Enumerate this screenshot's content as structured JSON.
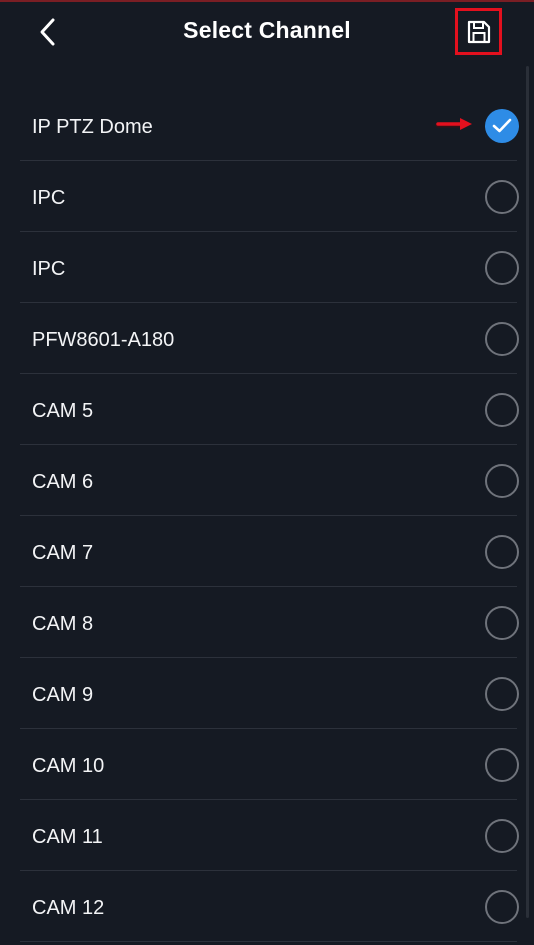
{
  "header": {
    "title": "Select Channel",
    "back_icon": "chevron-left-icon",
    "save_icon": "floppy-disk-icon",
    "save_highlight_color": "#e3101e"
  },
  "channels": [
    {
      "label": "IP PTZ Dome",
      "selected": true
    },
    {
      "label": "IPC",
      "selected": false
    },
    {
      "label": "IPC",
      "selected": false
    },
    {
      "label": "PFW8601-A180",
      "selected": false
    },
    {
      "label": "CAM 5",
      "selected": false
    },
    {
      "label": "CAM 6",
      "selected": false
    },
    {
      "label": "CAM 7",
      "selected": false
    },
    {
      "label": "CAM 8",
      "selected": false
    },
    {
      "label": "CAM 9",
      "selected": false
    },
    {
      "label": "CAM 10",
      "selected": false
    },
    {
      "label": "CAM 11",
      "selected": false
    },
    {
      "label": "CAM 12",
      "selected": false
    }
  ],
  "colors": {
    "background": "#151a23",
    "selected_accent": "#2e8ce6",
    "annotation_arrow": "#e3101e"
  }
}
